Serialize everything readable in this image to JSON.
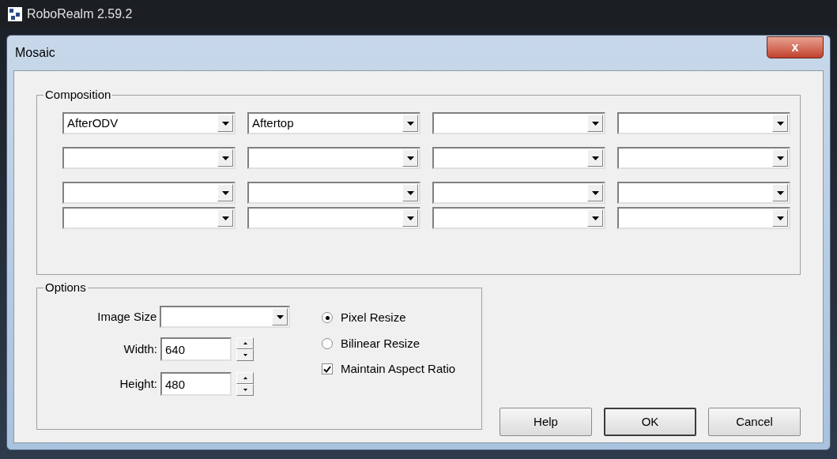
{
  "app_window": {
    "title": "RoboRealm 2.59.2"
  },
  "dialog": {
    "title": "Mosaic",
    "close_label": "x"
  },
  "composition": {
    "title": "Composition",
    "rows": [
      [
        "AfterODV",
        "Aftertop",
        "",
        ""
      ],
      [
        "",
        "",
        "",
        ""
      ],
      [
        "",
        "",
        "",
        ""
      ],
      [
        "",
        "",
        "",
        ""
      ]
    ]
  },
  "options": {
    "title": "Options",
    "image_size": {
      "label": "Image Size"
    },
    "width": {
      "label": "Width:",
      "value": "640"
    },
    "height": {
      "label": "Height:",
      "value": "480"
    },
    "resize_modes": [
      {
        "label": "Pixel Resize",
        "selected": true
      },
      {
        "label": "Bilinear Resize",
        "selected": false
      }
    ],
    "maintain_aspect": {
      "label": "Maintain Aspect Ratio",
      "checked": true
    }
  },
  "buttons": [
    {
      "label": "Help",
      "default": false
    },
    {
      "label": "OK",
      "default": true
    },
    {
      "label": "Cancel",
      "default": false
    }
  ]
}
